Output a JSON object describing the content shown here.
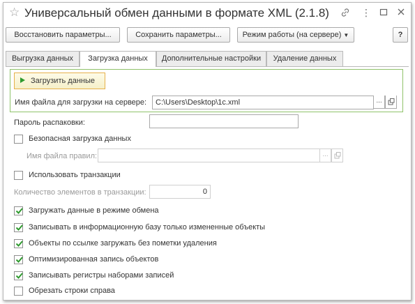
{
  "window": {
    "title": "Универсальный обмен данными в формате XML (2.1.8)",
    "star_icon": "☆",
    "menu_icon": "⋮"
  },
  "toolbar": {
    "restore_label": "Восстановить параметры...",
    "save_label": "Сохранить параметры...",
    "mode_label": "Режим работы (на сервере)",
    "help_label": "?"
  },
  "tabs": [
    {
      "label": "Выгрузка данных",
      "active": false
    },
    {
      "label": "Загрузка данных",
      "active": true
    },
    {
      "label": "Дополнительные настройки",
      "active": false
    },
    {
      "label": "Удаление данных",
      "active": false
    }
  ],
  "load": {
    "button_label": "Загрузить данные",
    "file_label": "Имя файла для загрузки на сервере:",
    "file_value": "C:\\Users\\Desktop\\1c.xml",
    "select_btn": "..."
  },
  "unpack": {
    "label": "Пароль распаковки:",
    "value": ""
  },
  "safe_load": {
    "label": "Безопасная загрузка данных",
    "checked": false,
    "rules_label": "Имя файла правил:",
    "rules_value": "",
    "select_btn": "..."
  },
  "transactions": {
    "label": "Использовать транзакции",
    "checked": false,
    "count_label": "Количество элементов в транзакции:",
    "count_value": "0"
  },
  "options": [
    {
      "label": "Загружать данные в режиме обмена",
      "checked": true
    },
    {
      "label": "Записывать в информационную базу только измененные объекты",
      "checked": true
    },
    {
      "label": "Объекты по ссылке загружать без пометки удаления",
      "checked": true
    },
    {
      "label": "Оптимизированная запись объектов",
      "checked": true
    },
    {
      "label": "Записывать регистры наборами записей",
      "checked": true
    },
    {
      "label": "Обрезать строки справа",
      "checked": false
    }
  ],
  "colors": {
    "accent_green": "#2e9a2e",
    "group_border": "#8fc26a",
    "button_highlight": "#e6b04a"
  }
}
